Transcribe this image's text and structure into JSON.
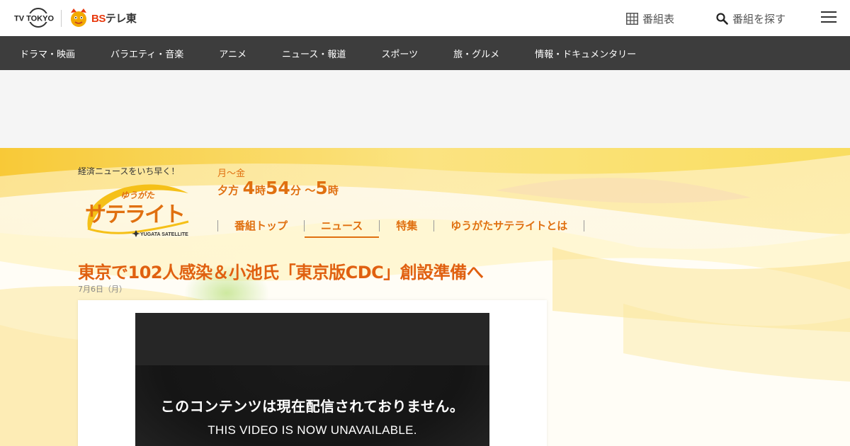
{
  "header": {
    "logo_tvtokyo": "TV TOKYO",
    "logo_bs_prefix": "BS",
    "logo_bs_suffix": "テレ東",
    "schedule_label": "番組表",
    "search_label": "番組を探す"
  },
  "genre_nav": {
    "items": [
      "ドラマ・映画",
      "バラエティ・音楽",
      "アニメ",
      "ニュース・報道",
      "スポーツ",
      "旅・グルメ",
      "情報・ドキュメンタリー"
    ]
  },
  "program": {
    "catch_copy": "経済ニュースをいち早く！",
    "logo_kana": "ゆうがた",
    "logo_main": "サテライト",
    "logo_en": "YUGATA SATELLITE",
    "days": "月～金",
    "air_prefix": "夕方",
    "air_hour_start": "4",
    "air_hour_unit": "時",
    "air_min_start": "54",
    "air_min_unit": "分",
    "air_tilde": "～",
    "air_hour_end": "5",
    "air_hour_end_unit": "時",
    "nav": [
      "番組トップ",
      "ニュース",
      "特集",
      "ゆうがたサテライトとは"
    ],
    "nav_active": 1
  },
  "article": {
    "title": "東京で102人感染＆小池氏「東京版CDC」創設準備へ",
    "date": "7月6日（月）"
  },
  "video": {
    "message_jp": "このコンテンツは現在配信されておりません。",
    "message_en": "THIS VIDEO IS NOW UNAVAILABLE."
  },
  "colors": {
    "accent": "#e07010",
    "nav_bg": "#3d3d3d"
  },
  "icons": {
    "schedule": "grid-icon",
    "search": "search-icon",
    "menu": "hamburger-icon"
  }
}
